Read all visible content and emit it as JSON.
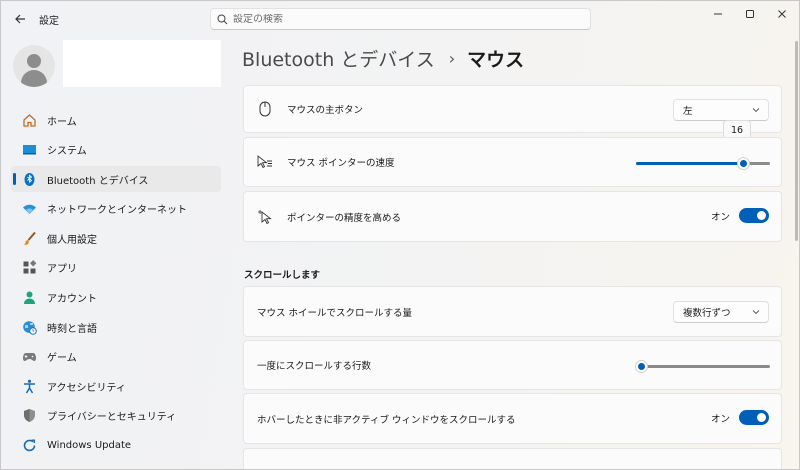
{
  "window": {
    "title": "設定"
  },
  "search": {
    "placeholder": "設定の検索"
  },
  "sidebar": {
    "items": [
      {
        "label": "ホーム",
        "icon": "home-icon",
        "selected": false
      },
      {
        "label": "システム",
        "icon": "system-icon",
        "selected": false
      },
      {
        "label": "Bluetooth とデバイス",
        "icon": "bluetooth-icon",
        "selected": true
      },
      {
        "label": "ネットワークとインターネット",
        "icon": "wifi-icon",
        "selected": false
      },
      {
        "label": "個人用設定",
        "icon": "brush-icon",
        "selected": false
      },
      {
        "label": "アプリ",
        "icon": "apps-icon",
        "selected": false
      },
      {
        "label": "アカウント",
        "icon": "account-icon",
        "selected": false
      },
      {
        "label": "時刻と言語",
        "icon": "globe-clock-icon",
        "selected": false
      },
      {
        "label": "ゲーム",
        "icon": "gamepad-icon",
        "selected": false
      },
      {
        "label": "アクセシビリティ",
        "icon": "accessibility-icon",
        "selected": false
      },
      {
        "label": "プライバシーとセキュリティ",
        "icon": "shield-icon",
        "selected": false
      },
      {
        "label": "Windows Update",
        "icon": "update-icon",
        "selected": false
      }
    ]
  },
  "breadcrumb": {
    "parent": "Bluetooth とデバイス",
    "separator": "›",
    "current": "マウス"
  },
  "settings": {
    "primary_button": {
      "label": "マウスの主ボタン",
      "value": "左"
    },
    "pointer_speed": {
      "label": "マウス ポインターの速度",
      "value": "16",
      "fraction": 0.8
    },
    "precision": {
      "label": "ポインターの精度を高める",
      "state": "オン"
    },
    "scroll_section": {
      "title": "スクロールします"
    },
    "wheel_amount": {
      "label": "マウス ホイールでスクロールする量",
      "value": "複数行ずつ"
    },
    "lines_per_scroll": {
      "label": "一度にスクロールする行数",
      "fraction": 0.04
    },
    "inactive_scroll": {
      "label": "ホバーしたときに非アクティブ ウィンドウをスクロールする",
      "state": "オン"
    }
  },
  "colors": {
    "accent": "#005fb8",
    "selected_bg": "#e9e9e9",
    "card_bg": "#fbfbfb"
  }
}
